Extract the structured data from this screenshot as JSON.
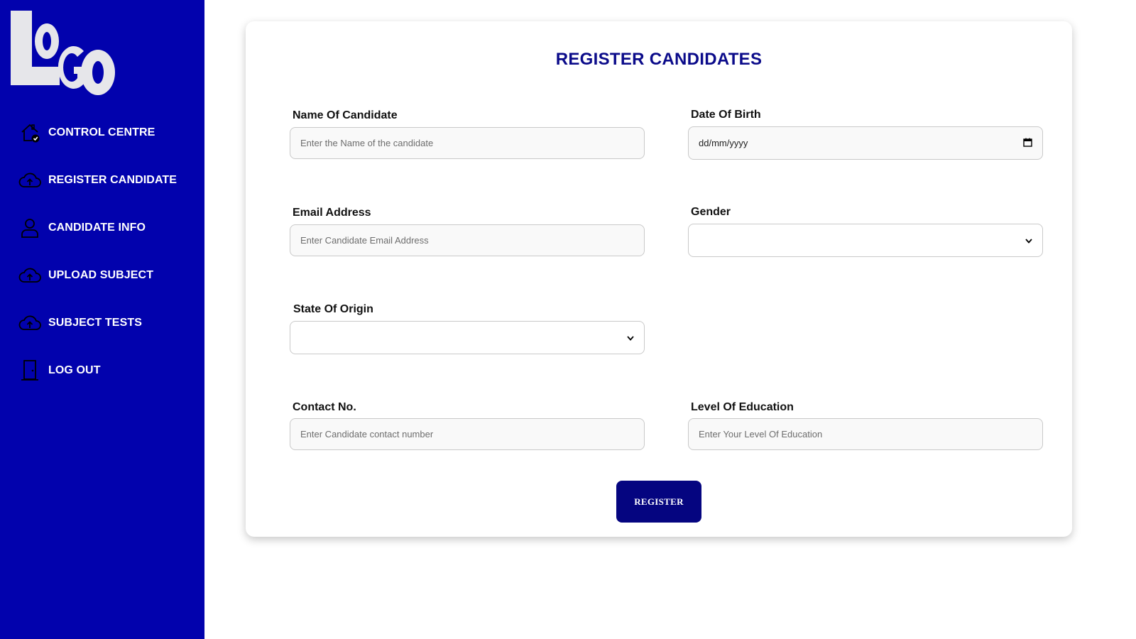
{
  "logo": {
    "text": "LOGO"
  },
  "sidebar": {
    "items": [
      {
        "label": "CONTROL CENTRE",
        "icon": "home-check-icon"
      },
      {
        "label": "REGISTER CANDIDATE",
        "icon": "cloud-upload-icon"
      },
      {
        "label": "CANDIDATE INFO",
        "icon": "user-icon"
      },
      {
        "label": "UPLOAD SUBJECT",
        "icon": "cloud-upload-icon"
      },
      {
        "label": "SUBJECT TESTS",
        "icon": "cloud-upload-icon"
      },
      {
        "label": "LOG OUT",
        "icon": "door-icon"
      }
    ]
  },
  "form": {
    "title": "REGISTER CANDIDATES",
    "fields": {
      "name": {
        "label": "Name Of Candidate",
        "placeholder": "Enter the Name of the candidate",
        "value": ""
      },
      "dob": {
        "label": "Date Of Birth",
        "placeholder": "dd/mm/yyyy",
        "value": ""
      },
      "email": {
        "label": "Email Address",
        "placeholder": "Enter Candidate Email Address",
        "value": ""
      },
      "gender": {
        "label": "Gender",
        "selected": ""
      },
      "state": {
        "label": "State Of Origin",
        "selected": ""
      },
      "contact": {
        "label": "Contact No.",
        "placeholder": "Enter Candidate contact number",
        "value": ""
      },
      "education": {
        "label": "Level Of Education",
        "placeholder": "Enter Your Level Of Education",
        "value": ""
      }
    },
    "submit_label": "REGISTER"
  },
  "colors": {
    "sidebar_bg": "#0202ad",
    "title": "#0b0b8a",
    "button_bg": "#050580",
    "logo": "#e6e6ea"
  }
}
